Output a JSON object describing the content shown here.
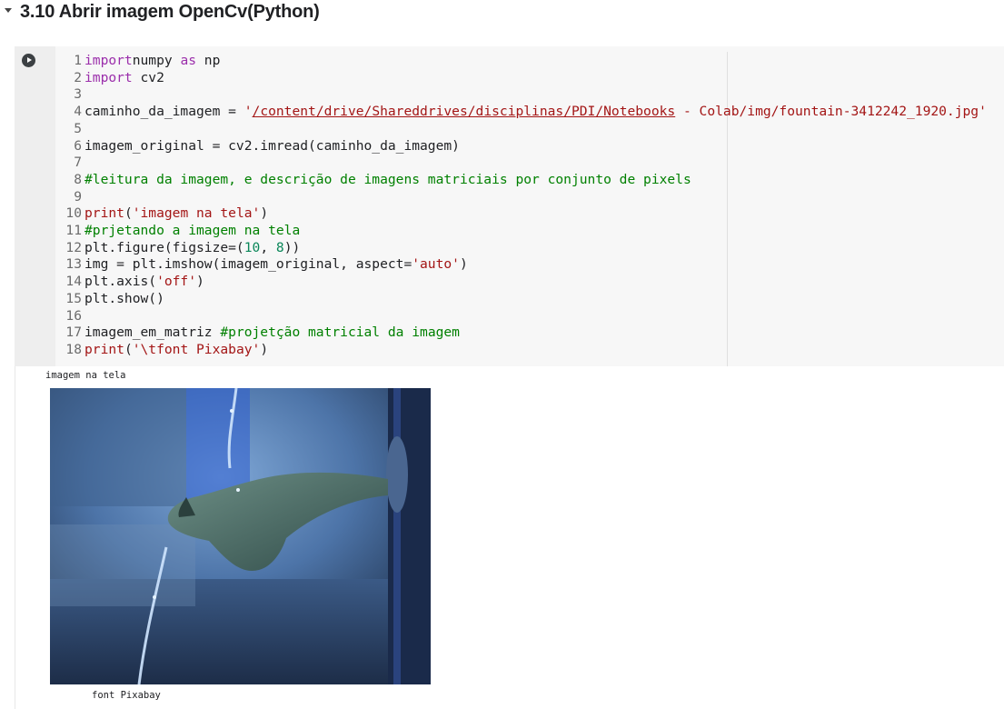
{
  "section": {
    "title": "3.10 Abrir imagem OpenCv(Python)"
  },
  "code": {
    "lines": [
      {
        "n": "1",
        "parts": [
          [
            "kw",
            "import"
          ],
          [
            "",
            "numpy "
          ],
          [
            "kw",
            "as"
          ],
          [
            "",
            " np"
          ]
        ]
      },
      {
        "n": "2",
        "parts": [
          [
            "kw",
            "import"
          ],
          [
            "",
            " cv2"
          ]
        ]
      },
      {
        "n": "3",
        "parts": []
      },
      {
        "n": "4",
        "parts": [
          [
            "",
            "caminho_da_imagem = "
          ],
          [
            "str",
            "'"
          ],
          [
            "str link",
            "/content/drive/Shareddrives/disciplinas/PDI/Notebooks"
          ],
          [
            "str",
            " - Colab/img/fountain-3412242_1920.jpg'"
          ]
        ]
      },
      {
        "n": "5",
        "parts": []
      },
      {
        "n": "6",
        "parts": [
          [
            "",
            "imagem_original = cv2.imread(caminho_da_imagem)"
          ]
        ]
      },
      {
        "n": "7",
        "parts": []
      },
      {
        "n": "8",
        "parts": [
          [
            "cm",
            "#leitura da imagem, e descrição de imagens matriciais por conjunto de pixels"
          ]
        ]
      },
      {
        "n": "9",
        "parts": []
      },
      {
        "n": "10",
        "parts": [
          [
            "str",
            "print"
          ],
          [
            "",
            "("
          ],
          [
            "str",
            "'imagem na tela'"
          ],
          [
            "",
            ")"
          ]
        ]
      },
      {
        "n": "11",
        "parts": [
          [
            "cm",
            "#prjetando a imagem na tela"
          ]
        ]
      },
      {
        "n": "12",
        "parts": [
          [
            "",
            "plt.figure(figsize=("
          ],
          [
            "num",
            "10"
          ],
          [
            "",
            ", "
          ],
          [
            "num",
            "8"
          ],
          [
            "",
            "))"
          ]
        ]
      },
      {
        "n": "13",
        "parts": [
          [
            "",
            "img = plt.imshow(imagem_original, aspect="
          ],
          [
            "str",
            "'auto'"
          ],
          [
            "",
            ")"
          ]
        ]
      },
      {
        "n": "14",
        "parts": [
          [
            "",
            "plt.axis("
          ],
          [
            "str",
            "'off'"
          ],
          [
            "",
            ")"
          ]
        ]
      },
      {
        "n": "15",
        "parts": [
          [
            "",
            "plt.show()"
          ]
        ]
      },
      {
        "n": "16",
        "parts": []
      },
      {
        "n": "17",
        "parts": [
          [
            "",
            "imagem_em_matriz "
          ],
          [
            "cm",
            "#projetção matricial da imagem"
          ]
        ]
      },
      {
        "n": "18",
        "parts": [
          [
            "str",
            "print"
          ],
          [
            "",
            "("
          ],
          [
            "str",
            "'\\tfont Pixabay'"
          ],
          [
            "",
            ")"
          ]
        ]
      }
    ]
  },
  "output": {
    "line1": "imagem na tela",
    "line2": "font Pixabay"
  },
  "icons": {
    "run": "play-circle-icon",
    "collapse": "caret-down-icon"
  },
  "colors": {
    "keyword": "#9b2eab",
    "string": "#a31515",
    "number": "#098658",
    "comment": "#008000"
  }
}
